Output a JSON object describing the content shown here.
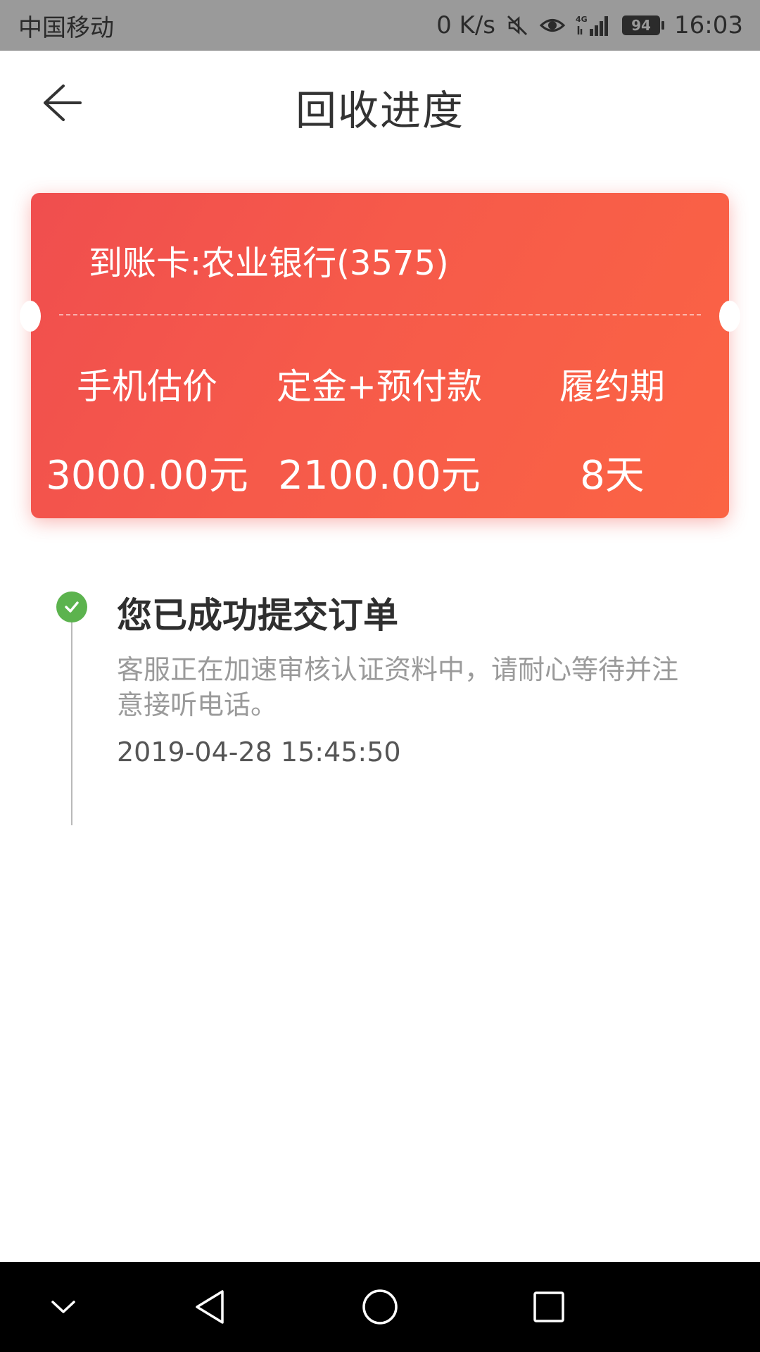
{
  "status_bar": {
    "carrier": "中国移动",
    "speed": "0 K/s",
    "network": "4G",
    "battery": "94",
    "time": "16:03"
  },
  "header": {
    "title": "回收进度",
    "back_icon": "back-arrow-icon"
  },
  "card": {
    "bank": "到账卡:农业银行(3575)",
    "columns": [
      {
        "label": "手机估价",
        "value": "3000.00元"
      },
      {
        "label": "定金+预付款",
        "value": "2100.00元"
      },
      {
        "label": "履约期",
        "value": "8天"
      }
    ],
    "colors": {
      "start": "#f04e4e",
      "end": "#fb6444"
    }
  },
  "timeline": {
    "steps": [
      {
        "title": "您已成功提交订单",
        "description": "客服正在加速审核认证资料中，请耐心等待并注意接听电话。",
        "time": "2019-04-28 15:45:50",
        "status_icon": "check-circle-icon",
        "status_color": "#5cb34e"
      }
    ]
  },
  "nav_bar": {
    "icons": [
      "chevron-down-icon",
      "back-triangle-icon",
      "home-circle-icon",
      "recents-square-icon"
    ]
  }
}
